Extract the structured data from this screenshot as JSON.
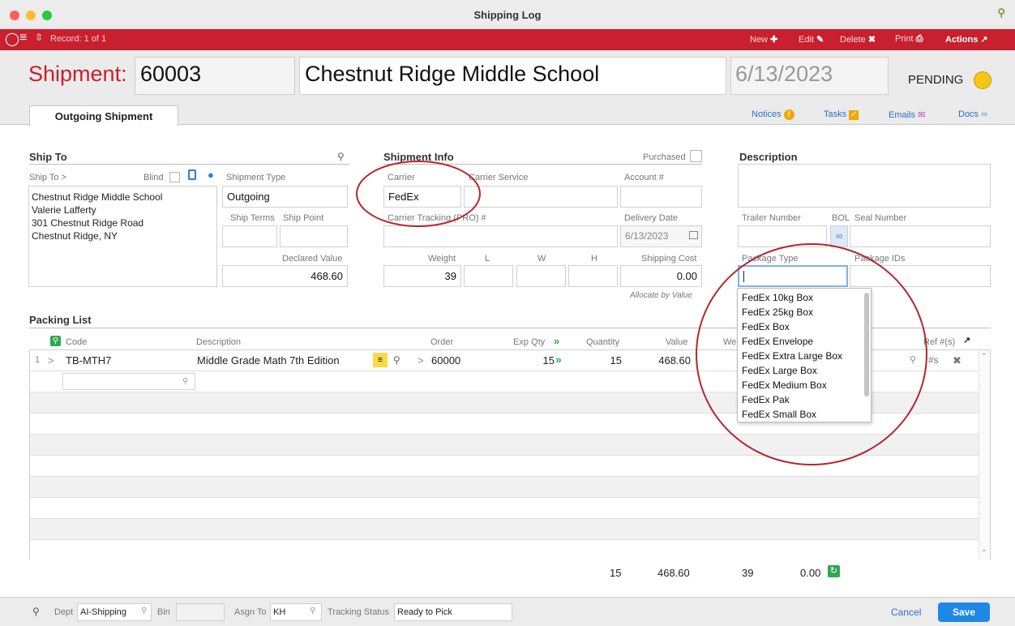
{
  "window": {
    "title": "Shipping Log"
  },
  "toolbar": {
    "record": "Record: 1 of 1",
    "new": "New",
    "edit": "Edit",
    "delete": "Delete",
    "print": "Print",
    "actions": "Actions"
  },
  "header": {
    "label": "Shipment:",
    "number": "60003",
    "name": "Chestnut Ridge Middle School",
    "date": "6/13/2023",
    "status": "PENDING",
    "status_color": "#f5c518"
  },
  "tabs": {
    "outgoing": "Outgoing Shipment"
  },
  "links": {
    "notices": "Notices",
    "tasks": "Tasks",
    "emails": "Emails",
    "docs": "Docs"
  },
  "ship_to": {
    "title": "Ship To",
    "ship_to_label": "Ship To >",
    "blind_label": "Blind",
    "address": [
      "Chestnut Ridge Middle School",
      "Valerie Lafferty",
      "301 Chestnut Ridge Road",
      "Chestnut Ridge, NY"
    ],
    "shipment_type_label": "Shipment Type",
    "shipment_type": "Outgoing",
    "ship_terms_label": "Ship Terms",
    "ship_point_label": "Ship Point",
    "declared_value_label": "Declared Value",
    "declared_value": "468.60"
  },
  "shipment_info": {
    "title": "Shipment Info",
    "purchased_label": "Purchased",
    "carrier_label": "Carrier",
    "carrier": "FedEx",
    "carrier_service_label": "Carrier Service",
    "account_label": "Account #",
    "tracking_label": "Carrier Tracking (PRO) #",
    "delivery_date_label": "Delivery Date",
    "delivery_date": "6/13/2023",
    "weight_label": "Weight",
    "l_label": "L",
    "w_label": "W",
    "h_label": "H",
    "weight": "39",
    "shipping_cost_label": "Shipping Cost",
    "shipping_cost": "0.00",
    "allocate_label": "Allocate by Value"
  },
  "description": {
    "title": "Description",
    "trailer_label": "Trailer Number",
    "bol_label": "BOL",
    "seal_label": "Seal Number",
    "package_type_label": "Package Type",
    "package_ids_label": "Package IDs",
    "package_options": [
      "FedEx 10kg Box",
      "FedEx 25kg Box",
      "FedEx Box",
      "FedEx Envelope",
      "FedEx Extra Large Box",
      "FedEx Large Box",
      "FedEx Medium Box",
      "FedEx Pak",
      "FedEx Small Box"
    ]
  },
  "packing_list": {
    "title": "Packing List",
    "columns": {
      "code": "Code",
      "description": "Description",
      "order": "Order",
      "exp_qty": "Exp Qty",
      "quantity": "Quantity",
      "value": "Value",
      "weight_partial": "We",
      "refs": "Ref #(s)"
    },
    "rows": [
      {
        "num": "1",
        "code": "TB-MTH7",
        "description": "Middle Grade Math 7th Edition",
        "order": "60000",
        "exp_qty": "15",
        "quantity": "15",
        "value": "468.60",
        "ref_symbol": "#s"
      }
    ],
    "totals": {
      "quantity": "15",
      "value": "468.60",
      "weight": "39",
      "cost": "0.00"
    }
  },
  "footer": {
    "dept_label": "Dept",
    "dept": "AI-Shipping",
    "bin_label": "Bin",
    "asgn_label": "Asgn To",
    "asgn": "KH",
    "tracking_status_label": "Tracking Status",
    "tracking_status": "Ready to Pick",
    "cancel": "Cancel",
    "save": "Save"
  }
}
